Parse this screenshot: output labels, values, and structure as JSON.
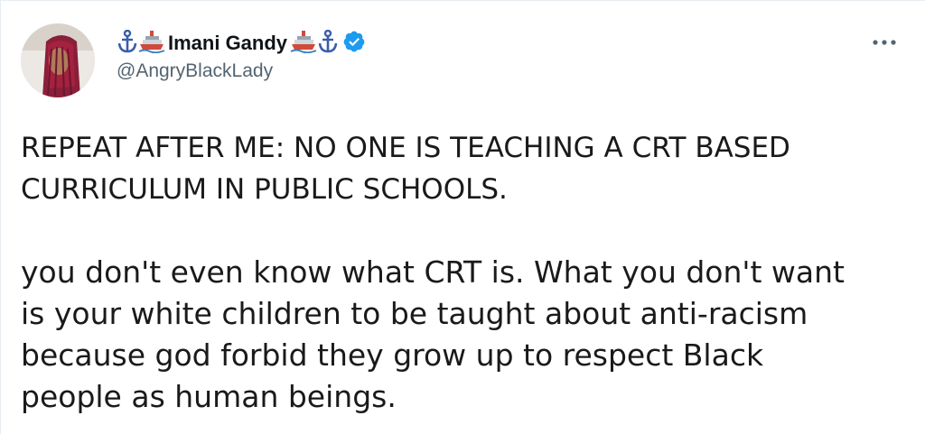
{
  "tweet": {
    "author": {
      "display_name": "Imani Gandy",
      "handle": "@AngryBlackLady",
      "verified": true,
      "name_emojis_left": [
        "anchor-emoji",
        "ship-emoji"
      ],
      "name_emojis_right": [
        "ship-emoji",
        "anchor-emoji"
      ]
    },
    "more_menu_icon": "more-dots-icon",
    "text_paragraphs": [
      "REPEAT AFTER ME: NO ONE IS TEACHING A CRT BASED\nCURRICULUM IN PUBLIC SCHOOLS.",
      "you don't even know what CRT is. What you don't want\nis your white children to be taught about anti-racism\nbecause god forbid they grow up to respect Black\npeople as human beings."
    ]
  },
  "colors": {
    "text_primary": "#0f1419",
    "text_secondary": "#536471",
    "verified_blue": "#1d9bf0",
    "anchor_blue": "#3b5ea8",
    "ship_red": "#d04a3a"
  }
}
